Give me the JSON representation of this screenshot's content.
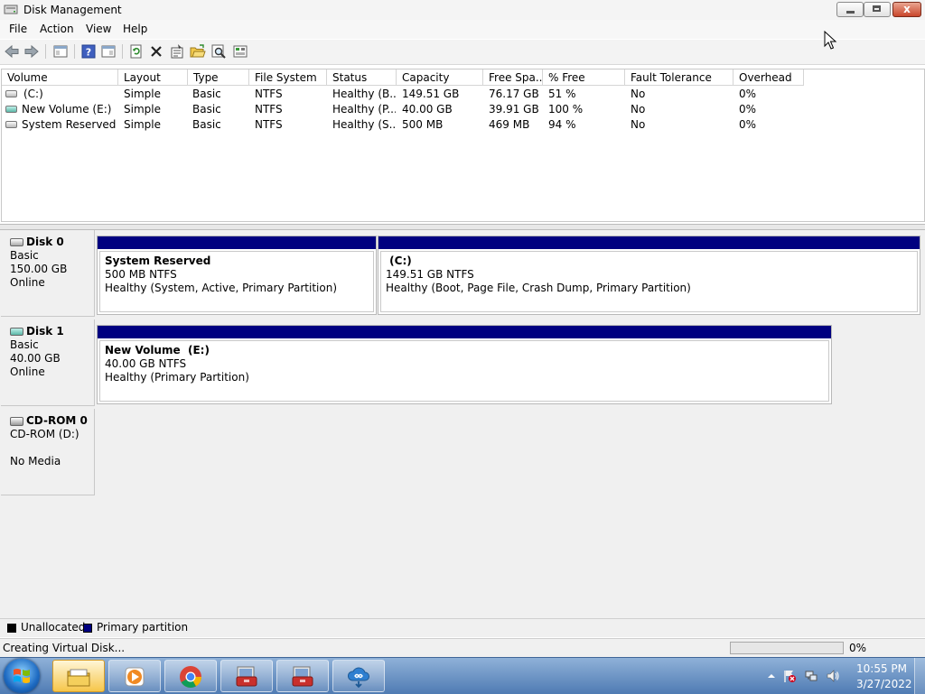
{
  "window": {
    "title": "Disk Management",
    "close_glyph": "x"
  },
  "menu": [
    "File",
    "Action",
    "View",
    "Help"
  ],
  "toolbar": {
    "icons": [
      "back-arrow-icon",
      "forward-arrow-icon",
      "show-hide-console-tree-icon",
      "help-icon",
      "properties-pane-icon",
      "refresh-icon",
      "delete-icon",
      "properties-icon",
      "open-folder-icon",
      "search-icon",
      "settings-icon"
    ]
  },
  "volume_table": {
    "columns": [
      "Volume",
      "Layout",
      "Type",
      "File System",
      "Status",
      "Capacity",
      "Free Spa...",
      "% Free",
      "Fault Tolerance",
      "Overhead"
    ],
    "rows": [
      {
        "volume": "(C:)",
        "layout": "Simple",
        "type": "Basic",
        "fs": "NTFS",
        "status": "Healthy (B...",
        "capacity": "149.51 GB",
        "free": "76.17 GB",
        "pct": "51 %",
        "fault": "No",
        "overhead": "0%"
      },
      {
        "volume": "New Volume (E:)",
        "layout": "Simple",
        "type": "Basic",
        "fs": "NTFS",
        "status": "Healthy (P...",
        "capacity": "40.00 GB",
        "free": "39.91 GB",
        "pct": "100 %",
        "fault": "No",
        "overhead": "0%"
      },
      {
        "volume": "System Reserved",
        "layout": "Simple",
        "type": "Basic",
        "fs": "NTFS",
        "status": "Healthy (S...",
        "capacity": "500 MB",
        "free": "469 MB",
        "pct": "94 %",
        "fault": "No",
        "overhead": "0%"
      }
    ]
  },
  "disks": [
    {
      "name": "Disk 0",
      "kind": "Basic",
      "size": "150.00 GB",
      "state": "Online",
      "partitions": [
        {
          "name": "System Reserved",
          "size": "500 MB NTFS",
          "status": "Healthy (System, Active, Primary Partition)"
        },
        {
          "name": " (C:)",
          "size": "149.51 GB NTFS",
          "status": "Healthy (Boot, Page File, Crash Dump, Primary Partition)"
        }
      ]
    },
    {
      "name": "Disk 1",
      "kind": "Basic",
      "size": "40.00 GB",
      "state": "Online",
      "partitions": [
        {
          "name": "New Volume  (E:)",
          "size": "40.00 GB NTFS",
          "status": "Healthy (Primary Partition)"
        }
      ]
    },
    {
      "name": "CD-ROM 0",
      "kind": "CD-ROM (D:)",
      "state": "No Media"
    }
  ],
  "legend": [
    {
      "label": "Unallocated",
      "color": "#000000"
    },
    {
      "label": "Primary partition",
      "color": "#000080"
    }
  ],
  "status": {
    "text": "Creating Virtual Disk...",
    "progress_percent": 0,
    "progress_label": "0%"
  },
  "taskbar": {
    "apps": [
      "file-explorer-icon",
      "media-player-icon",
      "chrome-icon",
      "computer-management-icon",
      "computer-management-icon",
      "cloud-download-icon"
    ],
    "time": "10:55 PM",
    "date": "3/27/2022"
  },
  "colors": {
    "primary_partition": "#000080",
    "accent": "#4f7bb3"
  }
}
